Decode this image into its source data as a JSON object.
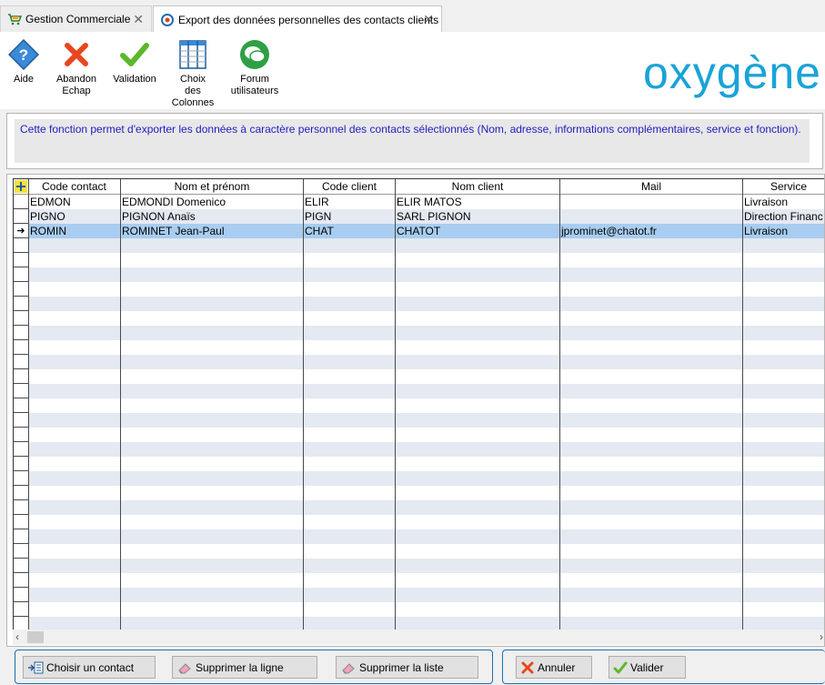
{
  "tabs": [
    {
      "label": "Gestion Commerciale",
      "active": false
    },
    {
      "label": "Export des données personnelles des contacts clients",
      "active": true
    }
  ],
  "toolbar": {
    "aide": "Aide",
    "abandon_l1": "Abandon",
    "abandon_l2": "Echap",
    "validation": "Validation",
    "choix_l1": "Choix",
    "choix_l2": "des",
    "choix_l3": "Colonnes",
    "forum_l1": "Forum",
    "forum_l2": "utilisateurs"
  },
  "logo": "oxygène",
  "info_text": "Cette fonction permet d'exporter les données à caractère personnel des contacts sélectionnés (Nom, adresse, informations complémentaires, service et fonction).",
  "grid": {
    "columns": [
      "Code contact",
      "Nom et prénom",
      "Code client",
      "Nom client",
      "Mail",
      "Service"
    ],
    "rows": [
      {
        "code_contact": "EDMON",
        "nom_prenom": "EDMONDI Domenico",
        "code_client": "ELIR",
        "nom_client": "ELIR MATOS",
        "mail": "",
        "service": "Livraison"
      },
      {
        "code_contact": "PIGNO",
        "nom_prenom": "PIGNON Anaïs",
        "code_client": "PIGN",
        "nom_client": "SARL PIGNON",
        "mail": "",
        "service": "Direction Financ"
      },
      {
        "code_contact": "ROMIN",
        "nom_prenom": "ROMINET Jean-Paul",
        "code_client": "CHAT",
        "nom_client": "CHATOT",
        "mail": "jprominet@chatot.fr",
        "service": "Livraison"
      }
    ],
    "selected_row": 2
  },
  "buttons": {
    "choisir": "Choisir un contact",
    "suppr_ligne": "Supprimer la ligne",
    "suppr_liste": "Supprimer la liste",
    "annuler": "Annuler",
    "valider": "Valider"
  },
  "colors": {
    "accent": "#1aa3d8",
    "info_text": "#2020c0",
    "selected_row": "#a8cdf0",
    "alt_row": "#e4e9f2"
  }
}
